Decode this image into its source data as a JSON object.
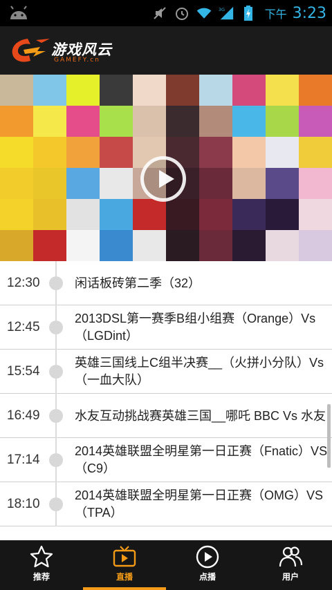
{
  "statusbar": {
    "ampm": "下午",
    "time": "3:23",
    "icons": [
      "android-icon",
      "mute-icon",
      "alarm-icon",
      "wifi-icon",
      "signal-3g-icon",
      "battery-icon"
    ]
  },
  "header": {
    "logo_text": "游戏风云",
    "logo_sub": "GAMEFY.cn"
  },
  "banner": {
    "play_icon": "play-icon"
  },
  "schedule": [
    {
      "time": "12:30",
      "title": "闲话板砖第二季（32）"
    },
    {
      "time": "12:45",
      "title": "2013DSL第一赛季B组小组赛（Orange）Vs（LGDint）"
    },
    {
      "time": "15:54",
      "title": "英雄三国线上C组半决赛__（火拼小分队）Vs（一血大队）"
    },
    {
      "time": "16:49",
      "title": "水友互动挑战赛英雄三国__哪吒 BBC Vs 水友"
    },
    {
      "time": "17:14",
      "title": "2014英雄联盟全明星第一日正赛（Fnatic）VS（C9）"
    },
    {
      "time": "18:10",
      "title": "2014英雄联盟全明星第一日正赛（OMG）VS（TPA）"
    }
  ],
  "nav": [
    {
      "label": "推荐",
      "icon": "star-icon"
    },
    {
      "label": "直播",
      "icon": "tv-icon"
    },
    {
      "label": "点播",
      "icon": "play-circle-icon"
    },
    {
      "label": "用户",
      "icon": "users-icon"
    }
  ],
  "colors": {
    "accent": "#f39b16",
    "status_blue": "#33b5e5"
  }
}
